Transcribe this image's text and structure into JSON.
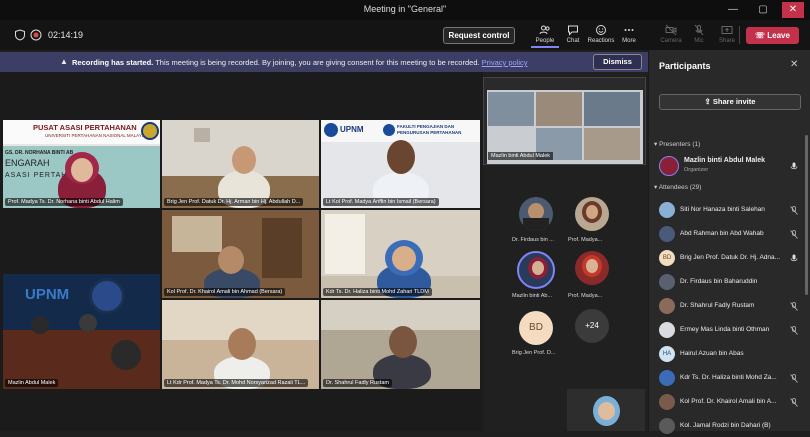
{
  "window": {
    "title": "Meeting in \"General\"",
    "minimize": "—",
    "maximize": "▢",
    "close": "✕"
  },
  "toolbar": {
    "timer": "02:14:19",
    "request_control": "Request control",
    "people": "People",
    "chat": "Chat",
    "reactions": "Reactions",
    "more": "More",
    "camera": "Camera",
    "mic": "Mic",
    "share": "Share",
    "leave": "Leave"
  },
  "banner": {
    "bold": "Recording has started.",
    "text": " This meeting is being recorded. By joining, you are giving consent for this meeting to be recorded. ",
    "link": "Privacy policy",
    "dismiss": "Dismiss"
  },
  "tiles": [
    {
      "name": "Prof. Madya Ts. Dr. Norhana binti Abdul Halim",
      "banner1": "PUSAT ASASI PERTAHANAN",
      "banner2": "UNIVERSITI PERTAHANAN NASIONAL MALAYSIA",
      "banner3": "GS. DR. NORHANA BINTI AB",
      "banner4": "ENGARAH",
      "banner5": "ASASI PERTAH"
    },
    {
      "name": "Brig Jen Prof. Datuk Dr. Hj. Arman bin Hj. Abdullah D..."
    },
    {
      "name": "Lt Kol Prof. Madya Ariffin bin Ismail (Bersara)",
      "logo": "UPNM",
      "faculty": "FAKULTI PENGAJIAN DAN PENGURUSAN PERTAHANAN"
    },
    {
      "name": "Kol Prof. Dr. Khairol Amali bin Ahmad (Bersara)"
    },
    {
      "name": "Kdr Ts. Dr. Haliza binti Mohd Zahari TLDM"
    },
    {
      "name": "Mazlin Abdul Malek",
      "logo": "UPNM"
    },
    {
      "name": "Lt Kdr Prof. Madya Ts. Dr. Mohd Norsyarizad Razali TL..."
    },
    {
      "name": "Dr. Shahrul Fadly Rustam"
    }
  ],
  "screen_share": {
    "name": "Mazlin binti Abdul Malek"
  },
  "gallery": [
    {
      "name": "Dr. Firdaus bin ..."
    },
    {
      "name": "Prof. Madya..."
    },
    {
      "name": "Mazlin binti Ab..."
    },
    {
      "name": "Prof. Madya..."
    },
    {
      "name": "Brig Jen Prof. D...",
      "initials": "BD"
    },
    {
      "name": "+24"
    }
  ],
  "participants": {
    "title": "Participants",
    "share_invite": "Share invite",
    "presenters_label": "Presenters (1)",
    "presenter": {
      "name": "Mazlin binti Abdul Malek",
      "role": "Organizer"
    },
    "attendees_label": "Attendees (29)",
    "attendees": [
      {
        "name": "Siti Nor Hanaza binti Salehan"
      },
      {
        "name": "Abd Rahman bin Abd Wahab"
      },
      {
        "name": "Brig Jen Prof. Datuk Dr. Hj. Adna...",
        "initials": "BD"
      },
      {
        "name": "Dr. Firdaus bin Baharuddin"
      },
      {
        "name": "Dr. Shahrul Fadly Rustam"
      },
      {
        "name": "Ermey Mas Linda binti Othman"
      },
      {
        "name": "Hairul Azuan bin Abas",
        "initials": "HA"
      },
      {
        "name": "Kdr Ts. Dr. Haliza binti Mohd Za..."
      },
      {
        "name": "Kol Prof. Dr. Khairol Amali bin A..."
      },
      {
        "name": "Kol. Jamal Rodzi bin Dahari (B)"
      }
    ]
  },
  "colors": {
    "accent": "#7f85f5",
    "leave": "#c4314b",
    "banner": "#3d3e66"
  }
}
